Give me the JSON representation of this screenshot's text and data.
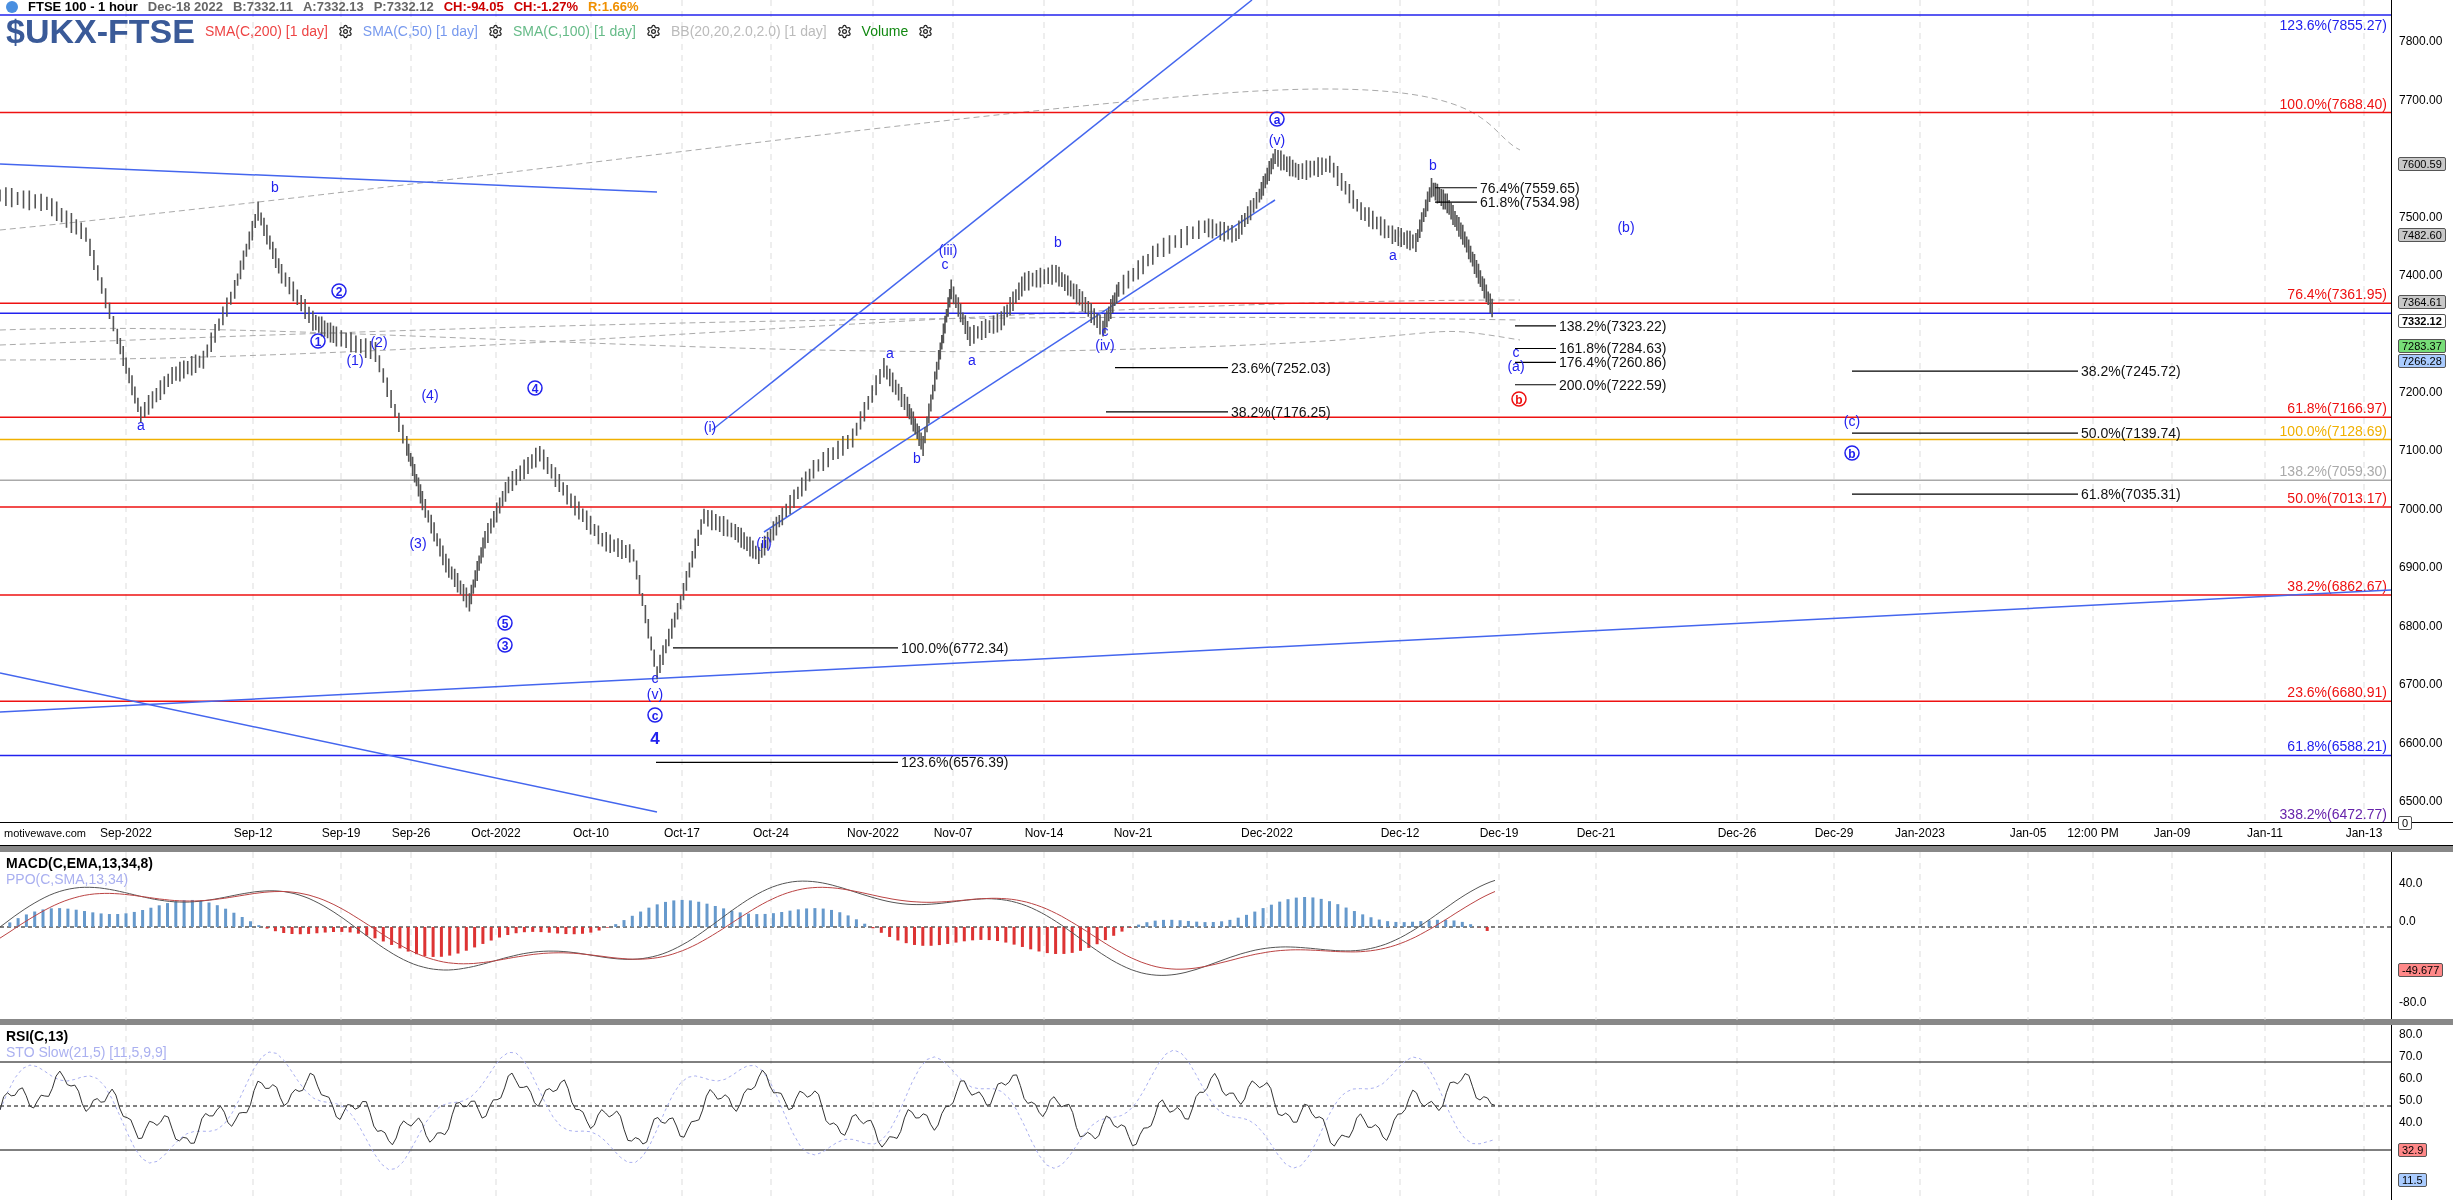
{
  "header": {
    "title": "FTSE 100 - 1 hour",
    "date": "Dec-18 2022",
    "bid": "B:7332.11",
    "ask": "A:7332.13",
    "price": "P:7332.12",
    "change": "CH:-94.05",
    "change_pct": "CH:-1.27%",
    "range": "R:1.66%"
  },
  "symbol": "$UKX-FTSE",
  "indicators": [
    {
      "label": "SMA(C,200) [1 day]",
      "color": "#ee4444"
    },
    {
      "label": "SMA(C,50) [1 day]",
      "color": "#7799ee"
    },
    {
      "label": "SMA(C,100) [1 day]",
      "color": "#66bb88"
    },
    {
      "label": "BB(20,20,2.0,2.0) [1 day]",
      "color": "#bbbbbb"
    },
    {
      "label": "Volume",
      "color": "#118811"
    }
  ],
  "fib_levels": [
    {
      "label": "123.6%(7855.27)",
      "color": "#2222ee"
    },
    {
      "label": "100.0%(7688.40)",
      "color": "#ee1111"
    },
    {
      "label": "76.4%(7361.95)",
      "color": "#ee1111"
    },
    {
      "label": "61.8%(7166.97)",
      "color": "#ee1111"
    },
    {
      "label": "100.0%(7128.69)",
      "color": "#f0b000"
    },
    {
      "label": "138.2%(7059.30)",
      "color": "#aaaaaa"
    },
    {
      "label": "50.0%(7013.17)",
      "color": "#ee1111"
    },
    {
      "label": "38.2%(6862.67)",
      "color": "#ee1111"
    },
    {
      "label": "23.6%(6680.91)",
      "color": "#ee1111"
    },
    {
      "label": "61.8%(6588.21)",
      "color": "#2222ee"
    },
    {
      "label": "338.2%(6472.77)",
      "color": "#6622aa"
    }
  ],
  "fib_projections": [
    {
      "label": "76.4%(7559.65)"
    },
    {
      "label": "61.8%(7534.98)"
    },
    {
      "label": "138.2%(7323.22)"
    },
    {
      "label": "161.8%(7284.63)"
    },
    {
      "label": "176.4%(7260.86)"
    },
    {
      "label": "200.0%(7222.59)"
    },
    {
      "label": "23.6%(7252.03)"
    },
    {
      "label": "38.2%(7176.25)"
    },
    {
      "label": "100.0%(6772.34)"
    },
    {
      "label": "123.6%(6576.39)"
    },
    {
      "label": "38.2%(7245.72)"
    },
    {
      "label": "50.0%(7139.74)"
    },
    {
      "label": "61.8%(7035.31)"
    }
  ],
  "wave_labels": [
    {
      "text": "a",
      "kind": "plain",
      "color": "#2222ee"
    },
    {
      "text": "b",
      "kind": "plain",
      "color": "#2222ee"
    },
    {
      "text": "2",
      "kind": "circled",
      "color": "#2222ee"
    },
    {
      "text": "1",
      "kind": "circled",
      "color": "#2222ee"
    },
    {
      "text": "(2)",
      "kind": "plain",
      "color": "#2222ee"
    },
    {
      "text": "(1)",
      "kind": "plain",
      "color": "#2222ee"
    },
    {
      "text": "(4)",
      "kind": "plain",
      "color": "#2222ee"
    },
    {
      "text": "4",
      "kind": "circled",
      "color": "#2222ee"
    },
    {
      "text": "(3)",
      "kind": "plain",
      "color": "#2222ee"
    },
    {
      "text": "5",
      "kind": "circled",
      "color": "#2222ee"
    },
    {
      "text": "3",
      "kind": "circled",
      "color": "#2222ee"
    },
    {
      "text": "c",
      "kind": "plain",
      "color": "#2222ee"
    },
    {
      "text": "(v)",
      "kind": "plain",
      "color": "#2222ee"
    },
    {
      "text": "c",
      "kind": "circled",
      "color": "#2222ee"
    },
    {
      "text": "4",
      "kind": "bold",
      "color": "#2222ee"
    },
    {
      "text": "(i)",
      "kind": "plain",
      "color": "#2222ee"
    },
    {
      "text": "(ii)",
      "kind": "plain",
      "color": "#2222ee"
    },
    {
      "text": "a",
      "kind": "plain",
      "color": "#2222ee"
    },
    {
      "text": "b",
      "kind": "plain",
      "color": "#2222ee"
    },
    {
      "text": "(iii)",
      "kind": "plain",
      "color": "#2222ee"
    },
    {
      "text": "c",
      "kind": "plain",
      "color": "#2222ee"
    },
    {
      "text": "a",
      "kind": "plain",
      "color": "#2222ee"
    },
    {
      "text": "b",
      "kind": "plain",
      "color": "#2222ee"
    },
    {
      "text": "c",
      "kind": "plain",
      "color": "#2222ee"
    },
    {
      "text": "(iv)",
      "kind": "plain",
      "color": "#2222ee"
    },
    {
      "text": "a",
      "kind": "circled",
      "color": "#2222ee"
    },
    {
      "text": "(v)",
      "kind": "plain",
      "color": "#2222ee"
    },
    {
      "text": "a",
      "kind": "plain",
      "color": "#2222ee"
    },
    {
      "text": "b",
      "kind": "plain",
      "color": "#2222ee"
    },
    {
      "text": "c",
      "kind": "plain",
      "color": "#2222ee"
    },
    {
      "text": "(a)",
      "kind": "plain",
      "color": "#2222ee"
    },
    {
      "text": "b",
      "kind": "circled",
      "color": "#ee1111"
    },
    {
      "text": "(b)",
      "kind": "plain",
      "color": "#2222ee"
    },
    {
      "text": "(c)",
      "kind": "plain",
      "color": "#2222ee"
    },
    {
      "text": "b",
      "kind": "circled",
      "color": "#2222ee"
    }
  ],
  "price_axis": {
    "ticks": [
      "7800.00",
      "7700.00",
      "7500.00",
      "7400.00",
      "7200.00",
      "7100.00",
      "7000.00",
      "6900.00",
      "6800.00",
      "6700.00",
      "6600.00",
      "6500.00"
    ],
    "tags": [
      {
        "value": "7600.59",
        "color": "#c8c8c8"
      },
      {
        "value": "7482.60",
        "color": "#c8c8c8"
      },
      {
        "value": "7364.61",
        "color": "#c8c8c8"
      },
      {
        "value": "7332.12",
        "color": "#ffffff"
      },
      {
        "value": "7283.37",
        "color": "#77dd77"
      },
      {
        "value": "7266.28",
        "color": "#aaccff"
      },
      {
        "value": "0",
        "color": "#ffffff"
      }
    ]
  },
  "date_axis": [
    "Sep-2022",
    "Sep-12",
    "Sep-19",
    "Sep-26",
    "Oct-2022",
    "Oct-10",
    "Oct-17",
    "Oct-24",
    "Nov-2022",
    "Nov-07",
    "Nov-14",
    "Nov-21",
    "Dec-2022",
    "Dec-12",
    "Dec-19",
    "Dec-21",
    "Dec-26",
    "Dec-29",
    "Jan-2023",
    "Jan-05",
    "12:00 PM",
    "Jan-09",
    "Jan-11",
    "Jan-13"
  ],
  "source_label": "motivewave.com",
  "macd": {
    "title": "MACD(C,EMA,13,34,8)",
    "subtitle": "PPO(C,SMA,13,34)",
    "ticks": [
      "40.0",
      "0.0",
      "-80.0"
    ],
    "tags": [
      {
        "value": "-49.677",
        "color": "#ff8888"
      }
    ]
  },
  "rsi": {
    "title": "RSI(C,13)",
    "subtitle": "STO Slow(21,5) [11,5,9,9]",
    "ticks": [
      "80.0",
      "70.0",
      "60.0",
      "50.0",
      "40.0"
    ],
    "tags": [
      {
        "value": "32.9",
        "color": "#ff8888"
      },
      {
        "value": "11.5",
        "color": "#aaccff"
      }
    ]
  }
}
